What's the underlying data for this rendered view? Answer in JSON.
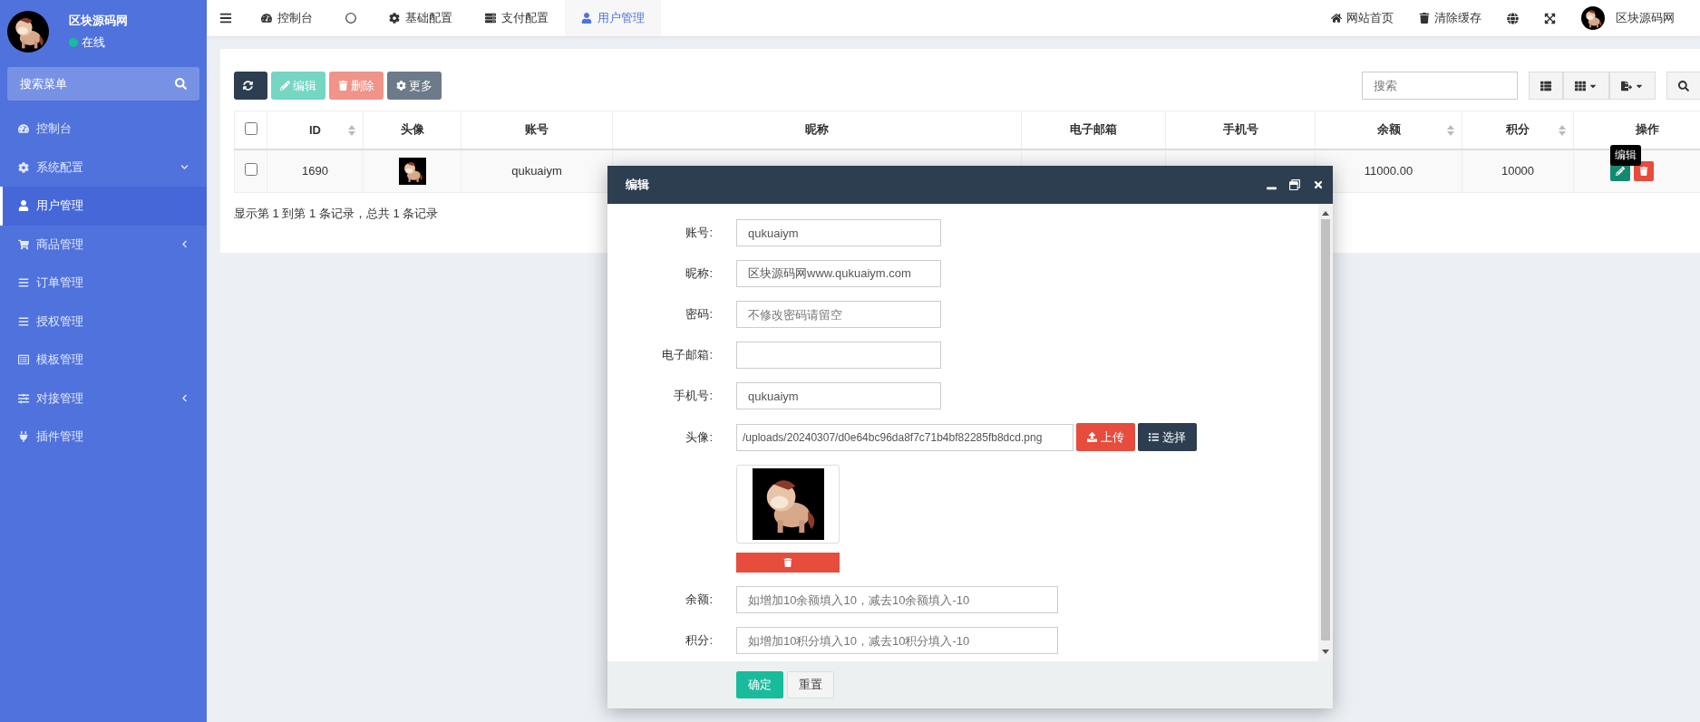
{
  "sidebar": {
    "brand": "区块源码网",
    "status": "在线",
    "search_placeholder": "搜索菜单",
    "items": [
      {
        "label": "控制台",
        "selected": false
      },
      {
        "label": "系统配置",
        "selected": false,
        "expanded": true
      },
      {
        "label": "用户管理",
        "selected": true
      },
      {
        "label": "商品管理",
        "selected": false,
        "expanded": false
      },
      {
        "label": "订单管理",
        "selected": false
      },
      {
        "label": "授权管理",
        "selected": false
      },
      {
        "label": "模板管理",
        "selected": false
      },
      {
        "label": "对接管理",
        "selected": false,
        "expanded": false
      },
      {
        "label": "插件管理",
        "selected": false
      }
    ]
  },
  "topbar": {
    "tabs": [
      {
        "label": "控制台",
        "selected": false
      },
      {
        "selected": false
      },
      {
        "label": "基础配置",
        "selected": false
      },
      {
        "label": "支付配置",
        "selected": false
      },
      {
        "label": "用户管理",
        "selected": true
      }
    ],
    "links": [
      "网站首页",
      "清除缓存"
    ],
    "user": "区块源码网"
  },
  "toolbar": {
    "buttons": [
      {
        "kind": "refresh",
        "disabled": false
      },
      {
        "kind": "edit",
        "label": "编辑",
        "disabled": true
      },
      {
        "kind": "delete",
        "label": "删除",
        "disabled": true
      },
      {
        "kind": "more",
        "label": "更多",
        "disabled": false
      }
    ],
    "search_placeholder": "搜索"
  },
  "table": {
    "header_checked": false,
    "columns": [
      {
        "label": "ID",
        "sortable": true
      },
      {
        "label": "头像",
        "sortable": false
      },
      {
        "label": "账号",
        "sortable": false
      },
      {
        "label": "昵称",
        "sortable": false
      },
      {
        "label": "电子邮箱",
        "sortable": false
      },
      {
        "label": "手机号",
        "sortable": false
      },
      {
        "label": "余额",
        "sortable": true
      },
      {
        "label": "积分",
        "sortable": true
      },
      {
        "label": "操作",
        "sortable": false
      }
    ],
    "rows": [
      {
        "checked": false,
        "id": "1690",
        "account": "qukuaiym",
        "balance": "11000.00",
        "points": "10000"
      }
    ],
    "tooltip": "编辑",
    "footer": "显示第 1 到第 1 条记录，总共 1 条记录"
  },
  "modal": {
    "title": "编辑",
    "fields": [
      {
        "kind": "short",
        "label": "账号:",
        "value": "qukuaiym"
      },
      {
        "kind": "short",
        "label": "昵称:",
        "value": "区块源码网www.qukuaiym.com"
      },
      {
        "kind": "short",
        "label": "密码:",
        "placeholder": "不修改密码请留空"
      },
      {
        "kind": "short",
        "label": "电子邮箱:"
      },
      {
        "kind": "short",
        "label": "手机号:",
        "value": "qukuaiym"
      },
      {
        "kind": "upload",
        "label": "头像:",
        "value": "/uploads/20240307/d0e64bc96da8f7c71b4bf82285fb8dcd.png",
        "upload": "上传",
        "choose": "选择"
      },
      {
        "kind": "long",
        "label": "余额:",
        "placeholder": "如增加10余额填入10，减去10余额填入-10"
      },
      {
        "kind": "long",
        "label": "积分:",
        "placeholder": "如增加10积分填入10，减去10积分填入-10"
      }
    ],
    "buttons": [
      {
        "kind": "primary",
        "label": "确定"
      },
      {
        "kind": "plain",
        "label": "重置"
      }
    ]
  }
}
